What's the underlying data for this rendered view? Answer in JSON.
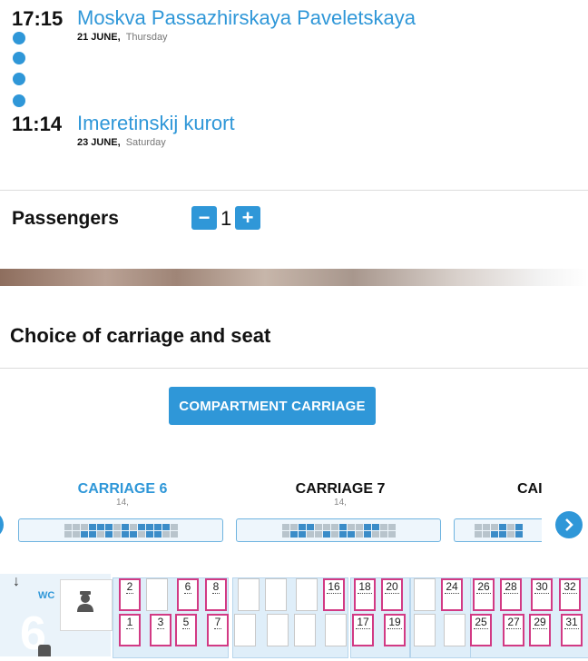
{
  "route": {
    "departure": {
      "time": "17:15",
      "station": "Moskva Passazhirskaya Paveletskaya",
      "date": "21 JUNE,",
      "day": "Thursday"
    },
    "arrival": {
      "time": "11:14",
      "station": "Imeretinskij kurort",
      "date": "23 JUNE,",
      "day": "Saturday"
    }
  },
  "passengers": {
    "label": "Passengers",
    "minus": "−",
    "count": "1",
    "plus": "+"
  },
  "section": {
    "title": "Choice of carriage and seat"
  },
  "carriage_type": {
    "label": "COMPARTMENT CARRIAGE"
  },
  "carriages": [
    {
      "name": "CARRIAGE 6",
      "sub": "14,",
      "active": true
    },
    {
      "name": "CARRIAGE 7",
      "sub": "14,",
      "active": false
    },
    {
      "name": "CAI",
      "sub": "",
      "active": false
    }
  ],
  "seatmap": {
    "wc_label": "WC",
    "carriage_number": "6",
    "upper_seats": [
      "2",
      "",
      "6",
      "8",
      "",
      "",
      "",
      "16",
      "18",
      "20",
      "",
      "24",
      "26",
      "28",
      "30",
      "32"
    ],
    "lower_seats": [
      "1",
      "3",
      "5",
      "7",
      "",
      "",
      "",
      "",
      "17",
      "19",
      "",
      "",
      "25",
      "27",
      "29",
      "31"
    ]
  },
  "colors": {
    "accent": "#2f97d8",
    "free_seat_border": "#d23a84"
  }
}
